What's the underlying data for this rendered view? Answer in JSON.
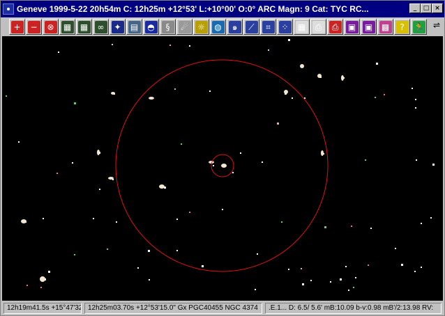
{
  "window": {
    "title": "Geneve 1999-5-22  20h54m C: 12h25m +12°53' L:+10°00' O:0° ARC Magn: 9 Cat: TYC RC...",
    "controls": {
      "minimize": "_",
      "maximize": "□",
      "close": "×"
    }
  },
  "toolbar": {
    "buttons": [
      {
        "name": "zoom-in-icon",
        "glyph": "+",
        "color": "#cc2222"
      },
      {
        "name": "zoom-out-icon",
        "glyph": "−",
        "color": "#cc2222"
      },
      {
        "name": "zoom-reset-icon",
        "glyph": "⊗",
        "color": "#cc2222"
      },
      {
        "name": "film-strip-icon",
        "glyph": "▦",
        "color": "#2e4f2e"
      },
      {
        "name": "film-strip-alt-icon",
        "glyph": "▦",
        "color": "#2e4f2e"
      },
      {
        "name": "binoculars-icon",
        "glyph": "∞",
        "color": "#2e4f2e"
      },
      {
        "name": "starfield-icon",
        "glyph": "✦",
        "color": "#1a2a8a"
      },
      {
        "name": "grid-icon",
        "glyph": "▤",
        "color": "#446688"
      },
      {
        "name": "dome-icon",
        "glyph": "◓",
        "color": "#1a2aa0"
      },
      {
        "name": "link-icon",
        "glyph": "§",
        "color": "#8a8a8a"
      },
      {
        "name": "comet-icon",
        "glyph": "☄",
        "color": "#9a9a9a"
      },
      {
        "name": "lightbulb-icon",
        "glyph": "☼",
        "color": "#b8a000"
      },
      {
        "name": "earth-globe-icon",
        "glyph": "◍",
        "color": "#1a6ab0"
      },
      {
        "name": "galaxy-icon",
        "glyph": "๑",
        "color": "#2a40a0"
      },
      {
        "name": "telescope-icon",
        "glyph": "⟋",
        "color": "#2a40a0"
      },
      {
        "name": "coordinate-grid-icon",
        "glyph": "⌗",
        "color": "#2a40a0"
      },
      {
        "name": "color-dots-icon",
        "glyph": "⁘",
        "color": "#2a40a0"
      },
      {
        "name": "calendar-icon",
        "glyph": "▦",
        "color": "#dddddd"
      },
      {
        "name": "printer-icon",
        "glyph": "⎙",
        "color": "#dddddd"
      },
      {
        "name": "print-color-icon",
        "glyph": "⎙",
        "color": "#cc2222"
      },
      {
        "name": "save-disk-icon",
        "glyph": "▣",
        "color": "#7a1aa0"
      },
      {
        "name": "save-disk-alt-icon",
        "glyph": "▣",
        "color": "#7a1aa0"
      },
      {
        "name": "palette-icon",
        "glyph": "▩",
        "color": "#c04090"
      },
      {
        "name": "help-icon",
        "glyph": "?",
        "color": "#d8c000"
      },
      {
        "name": "exit-running-man-icon",
        "glyph": "🏃",
        "color": "#20a040"
      }
    ]
  },
  "status": {
    "cursor_coords": "12h19m41.5s +15°47'32\"",
    "object_info": "12h25m03.70s +12°53'15.0\"  Gx PGC40455   NGC  4374",
    "details": ".E.1...  D:  6.5/ 5.6' mB:10.09 b-v:0.98 mB'/2:13.98 RV:"
  },
  "colors": {
    "sky_background": "#000000",
    "circle": "#e01010",
    "titlebar": "#000080"
  }
}
